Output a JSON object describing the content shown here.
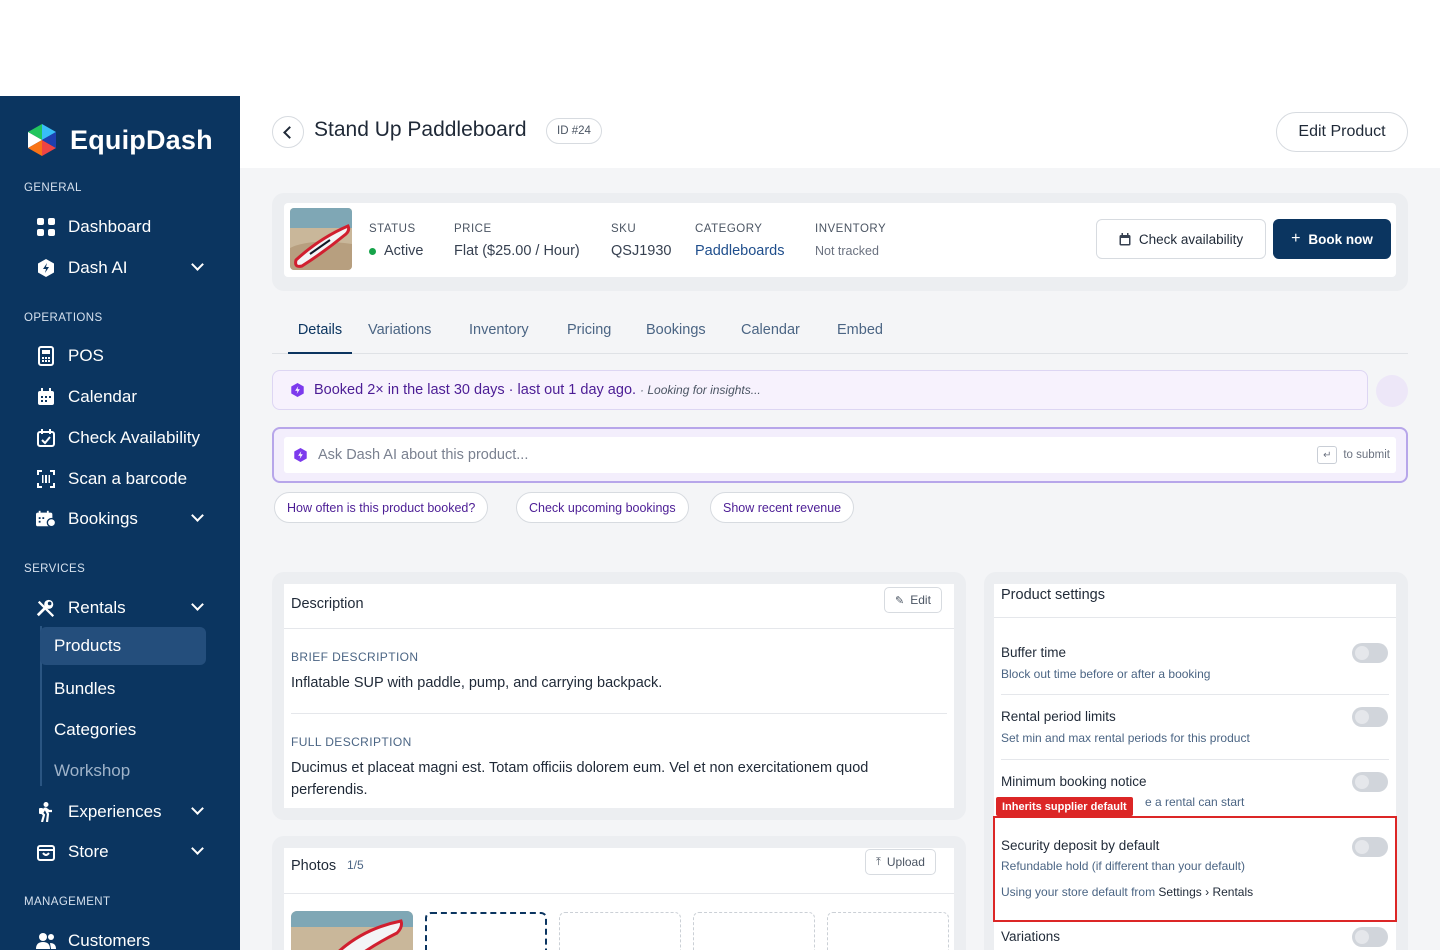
{
  "app": {
    "name": "EquipDash",
    "brand_color": "#0b3560"
  },
  "sidebar": {
    "sections": {
      "general": "GENERAL",
      "operations": "OPERATIONS",
      "services": "SERVICES",
      "management": "MANAGEMENT"
    },
    "items": {
      "dashboard": "Dashboard",
      "dash_ai": "Dash AI",
      "pos": "POS",
      "calendar": "Calendar",
      "check_availability": "Check Availability",
      "scan_barcode": "Scan a barcode",
      "bookings": "Bookings",
      "rentals": "Rentals",
      "experiences": "Experiences",
      "store": "Store",
      "customers": "Customers"
    },
    "rentals_sub": {
      "products": "Products",
      "bundles": "Bundles",
      "categories": "Categories",
      "workshop": "Workshop"
    }
  },
  "header": {
    "title": "Stand Up Paddleboard",
    "id_badge": "ID #24",
    "edit_button": "Edit Product"
  },
  "summary": {
    "status_label": "STATUS",
    "status_value": "Active",
    "price_label": "PRICE",
    "price_value": "Flat ($25.00 / Hour)",
    "sku_label": "SKU",
    "sku_value": "QSJ1930",
    "category_label": "CATEGORY",
    "category_value": "Paddleboards",
    "inventory_label": "INVENTORY",
    "inventory_value": "Not tracked",
    "check_button": "Check availability",
    "book_button": "Book now"
  },
  "tabs": [
    "Details",
    "Variations",
    "Inventory",
    "Pricing",
    "Bookings",
    "Calendar",
    "Embed"
  ],
  "insight": {
    "text": "Booked 2× in the last 30 days · last out 1 day ago.",
    "sub": "· Looking for insights..."
  },
  "ask": {
    "placeholder": "Ask Dash AI about this product...",
    "enter_key": "↵",
    "submit_hint": "to submit"
  },
  "chips": [
    "How often is this product booked?",
    "Check upcoming bookings",
    "Show recent revenue"
  ],
  "description": {
    "title": "Description",
    "edit_label": "Edit",
    "brief_label": "BRIEF DESCRIPTION",
    "brief_value": "Inflatable SUP with paddle, pump, and carrying backpack.",
    "full_label": "FULL DESCRIPTION",
    "full_value": "Ducimus et placeat magni est. Totam officiis dolorem eum. Vel et non exercitationem quod perferendis."
  },
  "photos": {
    "title": "Photos",
    "count": "1/5",
    "upload_label": "Upload"
  },
  "settings": {
    "title": "Product settings",
    "buffer_name": "Buffer time",
    "buffer_desc": "Block out time before or after a booking",
    "rental_name": "Rental period limits",
    "rental_desc": "Set min and max rental periods for this product",
    "notice_name": "Minimum booking notice",
    "notice_desc": "e a rental can start",
    "inherit_badge": "Inherits supplier default",
    "deposit_name": "Security deposit by default",
    "deposit_desc": "Refundable hold (if different than your default)",
    "deposit_note": "Using your store default from",
    "deposit_note_path": "Settings › Rentals",
    "variations_name": "Variations"
  }
}
